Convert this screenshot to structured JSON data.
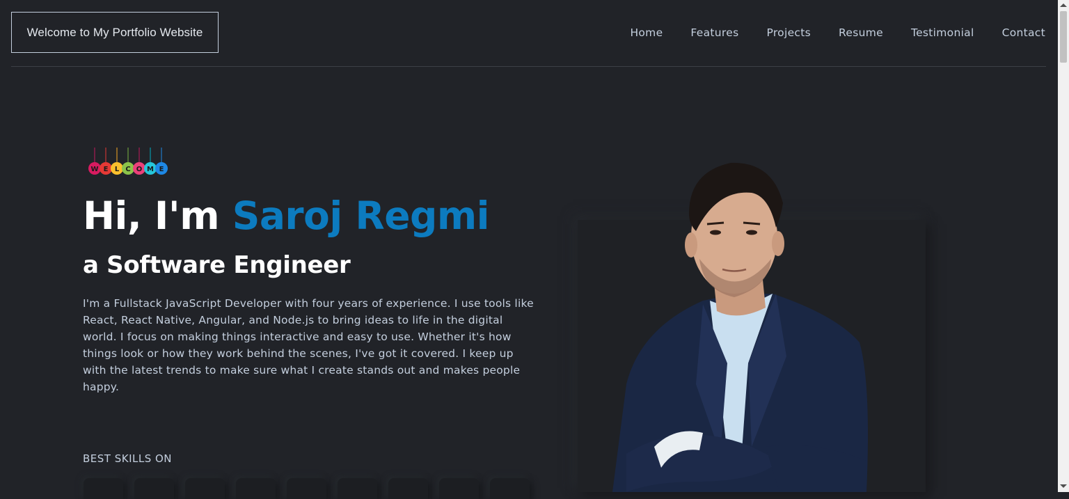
{
  "header": {
    "logo_text": "Welcome to My Portfolio Website",
    "nav": [
      {
        "label": "Home"
      },
      {
        "label": "Features"
      },
      {
        "label": "Projects"
      },
      {
        "label": "Resume"
      },
      {
        "label": "Testimonial"
      },
      {
        "label": "Contact"
      }
    ]
  },
  "hero": {
    "welcome_letters": [
      "W",
      "E",
      "L",
      "C",
      "O",
      "M",
      "E"
    ],
    "greeting": "Hi, I'm",
    "name": "Saroj Regmi",
    "role": "a Software Engineer",
    "description": "I'm a Fullstack JavaScript Developer with four years of experience. I use tools like React, React Native, Angular, and Node.js to bring ideas to life in the digital world. I focus on making things interactive and easy to use. Whether it's how things look or how they work behind the scenes, I've got it covered. I keep up with the latest trends to make sure what I create stands out and makes people happy.",
    "skills_label": "BEST SKILLS ON"
  },
  "colors": {
    "background": "#212328",
    "accent": "#0c7bbf",
    "text": "#c4cfde",
    "heading": "#ffffff"
  }
}
